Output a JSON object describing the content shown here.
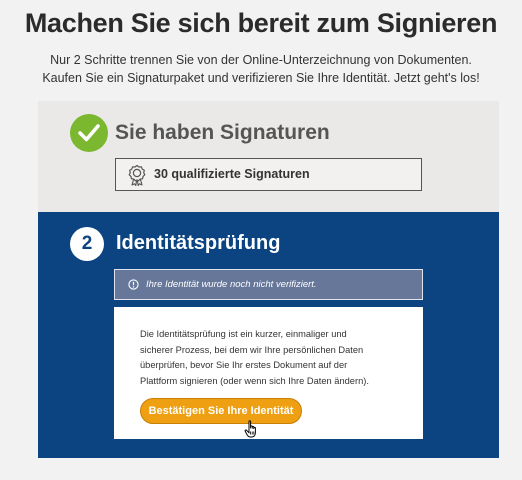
{
  "header": {
    "title": "Machen Sie sich bereit zum Signieren",
    "subtitle_lines": [
      "Nur 2 Schritte trennen Sie von der Online-Unterzeichnung von Dokumenten.",
      "Kaufen Sie ein Signaturpaket und verifizieren Sie Ihre Identität. Jetzt geht's los!"
    ]
  },
  "step1": {
    "status_icon": "check-icon",
    "title": "Sie haben Signaturen",
    "signatures_icon": "award-icon",
    "signatures_label": "30 qualifizierte Signaturen"
  },
  "step2": {
    "number": "2",
    "title": "Identitätsprüfung",
    "alert_icon": "info-icon",
    "alert_text": "Ihre Identität wurde noch nicht verifiziert.",
    "description_lines": [
      "Die Identitätsprüfung ist ein kurzer, einmaliger und",
      "sicherer Prozess, bei dem wir Ihre persönlichen Daten",
      "überprüfen, bevor Sie Ihr erstes Dokument auf der",
      "Plattform signieren (oder wenn sich Ihre Daten ändern)."
    ],
    "confirm_button": "Bestätigen Sie Ihre Identität"
  },
  "colors": {
    "background": "#f2f2f2",
    "step1_bg": "#ebe9e7",
    "step2_bg": "#0b4480",
    "success_green": "#7cb82f",
    "alert_bg": "#66779a",
    "button_orange": "#ee9f12"
  }
}
